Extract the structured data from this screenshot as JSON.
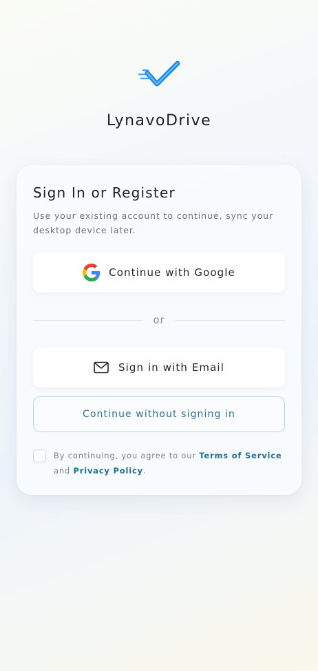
{
  "app": {
    "title": "LynavoDrive",
    "logo_icon": "checkmark-logo-icon"
  },
  "card": {
    "title": "Sign In or Register",
    "subtitle": "Use your existing account to continue, sync your desktop device later.",
    "google_button": {
      "label": "Continue with Google",
      "icon": "google-icon"
    },
    "divider_text": "or",
    "email_button": {
      "label": "Sign in with Email",
      "icon": "mail-icon"
    },
    "guest_button": {
      "label": "Continue without signing in"
    },
    "consent": {
      "checked": false,
      "prefix": "By continuing, you agree to our",
      "terms_link": "Terms of Service",
      "conjunction": "and",
      "privacy_link": "Privacy Policy",
      "suffix": "."
    }
  },
  "colors": {
    "accent": "#1f6f93",
    "logo_blue": "#1e88e5",
    "outline": "#b9d3e2"
  }
}
